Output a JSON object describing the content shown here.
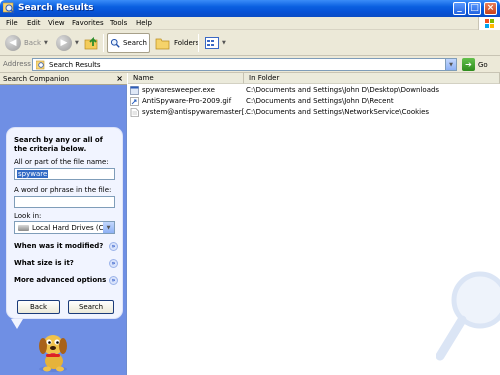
{
  "window": {
    "title": "Search Results"
  },
  "menu": [
    "File",
    "Edit",
    "View",
    "Favorites",
    "Tools",
    "Help"
  ],
  "toolbar": {
    "back": "Back",
    "search": "Search",
    "folders": "Folders"
  },
  "address": {
    "label": "Address",
    "value": "Search Results",
    "go": "Go"
  },
  "panel": {
    "title": "Search Companion",
    "heading": "Search by any or all of the criteria below.",
    "name_label": "All or part of the file name:",
    "name_value": "spyware",
    "phrase_label": "A word or phrase in the file:",
    "phrase_value": "",
    "lookin_label": "Look in:",
    "lookin_value": "Local Hard Drives (C:)",
    "modified": "When was it modified?",
    "size": "What size is it?",
    "advanced": "More advanced options",
    "back_button": "Back",
    "search_button": "Search"
  },
  "columns": {
    "name": "Name",
    "folder": "In Folder"
  },
  "rows": [
    {
      "name": "spywaresweeper.exe",
      "folder": "C:\\Documents and Settings\\John D\\Desktop\\Downloads",
      "icon": "exe-icon"
    },
    {
      "name": "AntiSpyware-Pro-2009.gif",
      "folder": "C:\\Documents and Settings\\John D\\Recent",
      "icon": "shortcut-icon"
    },
    {
      "name": "system@antispywaremaster[...",
      "folder": "C:\\Documents and Settings\\NetworkService\\Cookies",
      "icon": "cookie-icon"
    }
  ],
  "colors": {
    "titlebar": "#0a5fe0",
    "panel": "#6f8fe4",
    "chrome": "#ece9d8"
  }
}
